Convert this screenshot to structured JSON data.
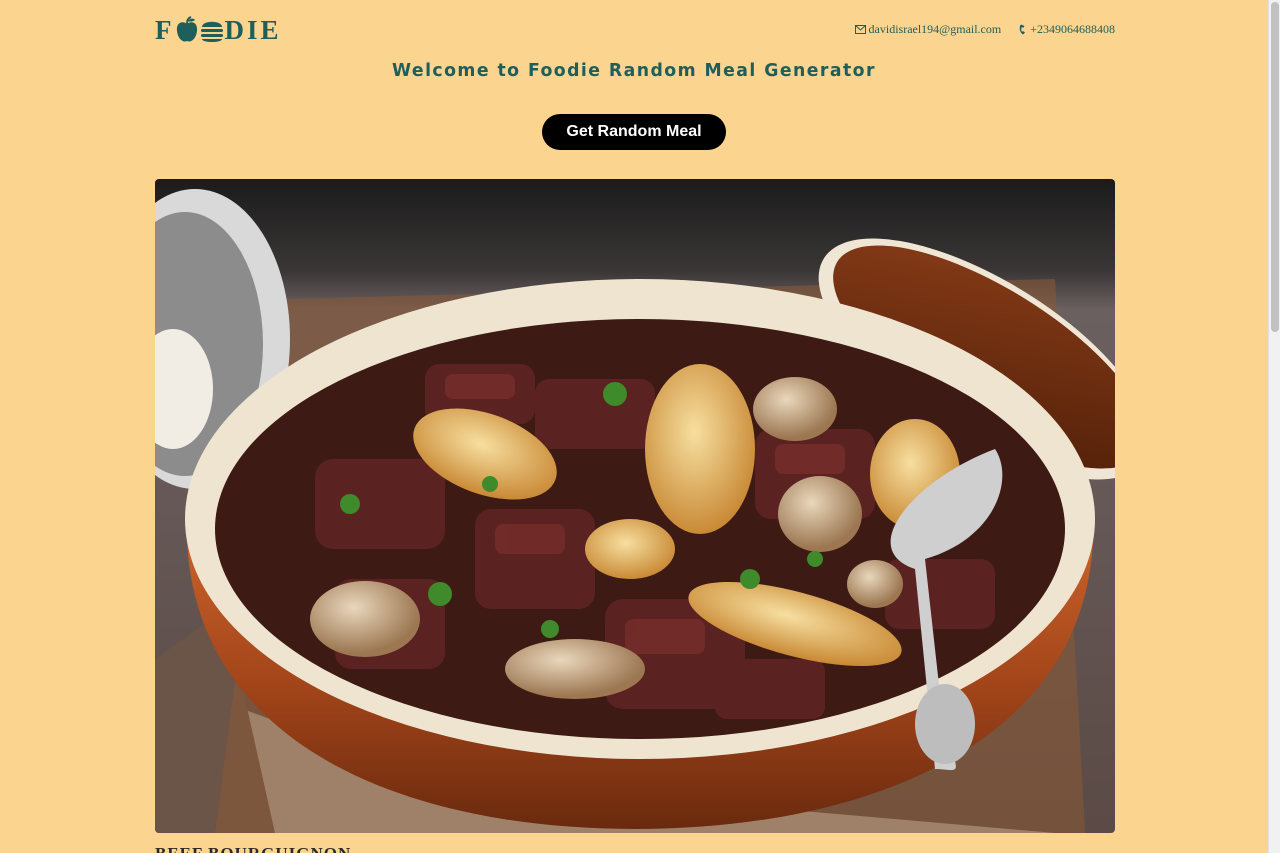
{
  "header": {
    "logo": {
      "letter_f": "F",
      "letters_die": "DIE",
      "icons": [
        "apple-icon",
        "burger-icon"
      ]
    },
    "contacts": {
      "email": "davidisrael194@gmail.com",
      "phone": "+2349064688408",
      "email_icon": "envelope-icon",
      "phone_icon": "phone-icon"
    }
  },
  "main": {
    "title": "Welcome to Foodie Random Meal Generator",
    "button_label": "Get Random Meal",
    "meal": {
      "image_alt": "beef-bourguignon-dish",
      "name": "BEEF BOURGUIGNON"
    }
  },
  "colors": {
    "background": "#fbd48f",
    "accent": "#1f5f5b",
    "button": "#000000",
    "button_text": "#ffffff"
  }
}
